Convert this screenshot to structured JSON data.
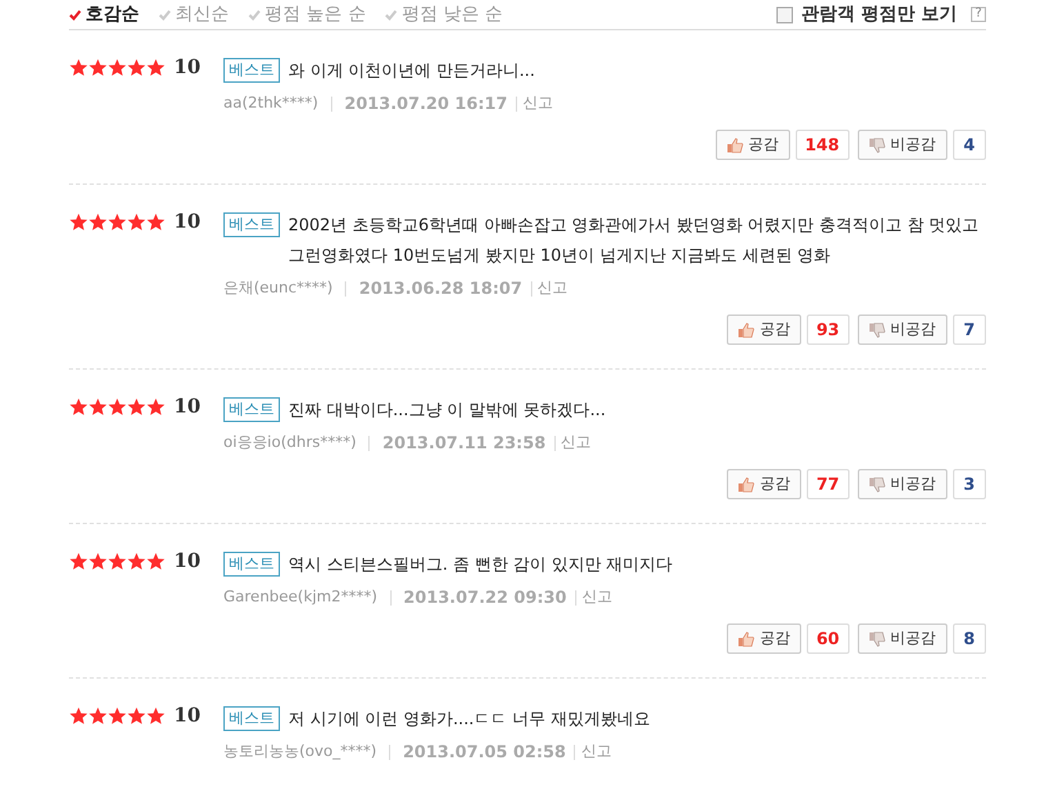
{
  "sort_tabs": [
    {
      "label": "호감순",
      "selected": true
    },
    {
      "label": "최신순",
      "selected": false
    },
    {
      "label": "평점 높은 순",
      "selected": false
    },
    {
      "label": "평점 낮은 순",
      "selected": false
    }
  ],
  "audience_filter": {
    "label": "관람객 평점만 보기",
    "checked": false,
    "help": "?"
  },
  "reviews": [
    {
      "stars": 5,
      "score": "10",
      "badge": "베스트",
      "text": "와 이게 이천이년에 만든거라니...",
      "author": "aa(2thk****)",
      "date": "2013.07.20 16:17",
      "report": "신고",
      "like_label": "공감",
      "likes": "148",
      "dislike_label": "비공감",
      "dislikes": "4"
    },
    {
      "stars": 5,
      "score": "10",
      "badge": "베스트",
      "text": "2002년 초등학교6학년때 아빠손잡고 영화관에가서 봤던영화 어렸지만 충격적이고 참 멋있고 그런영화였다 10번도넘게 봤지만 10년이 넘게지난 지금봐도 세련된 영화",
      "author": "은채(eunc****)",
      "date": "2013.06.28 18:07",
      "report": "신고",
      "like_label": "공감",
      "likes": "93",
      "dislike_label": "비공감",
      "dislikes": "7"
    },
    {
      "stars": 5,
      "score": "10",
      "badge": "베스트",
      "text": "진짜 대박이다...그냥 이 말밖에 못하겠다...",
      "author": "oi응응io(dhrs****)",
      "date": "2013.07.11 23:58",
      "report": "신고",
      "like_label": "공감",
      "likes": "77",
      "dislike_label": "비공감",
      "dislikes": "3"
    },
    {
      "stars": 5,
      "score": "10",
      "badge": "베스트",
      "text": "역시 스티븐스필버그. 좀 뻔한 감이 있지만 재미지다",
      "author": "Garenbee(kjm2****)",
      "date": "2013.07.22 09:30",
      "report": "신고",
      "like_label": "공감",
      "likes": "60",
      "dislike_label": "비공감",
      "dislikes": "8"
    },
    {
      "stars": 5,
      "score": "10",
      "badge": "베스트",
      "text": "저 시기에 이런 영화가....ㄷㄷ 너무 재밌게봤네요",
      "author": "농토리농농(ovo_****)",
      "date": "2013.07.05 02:58",
      "report": "신고"
    }
  ]
}
